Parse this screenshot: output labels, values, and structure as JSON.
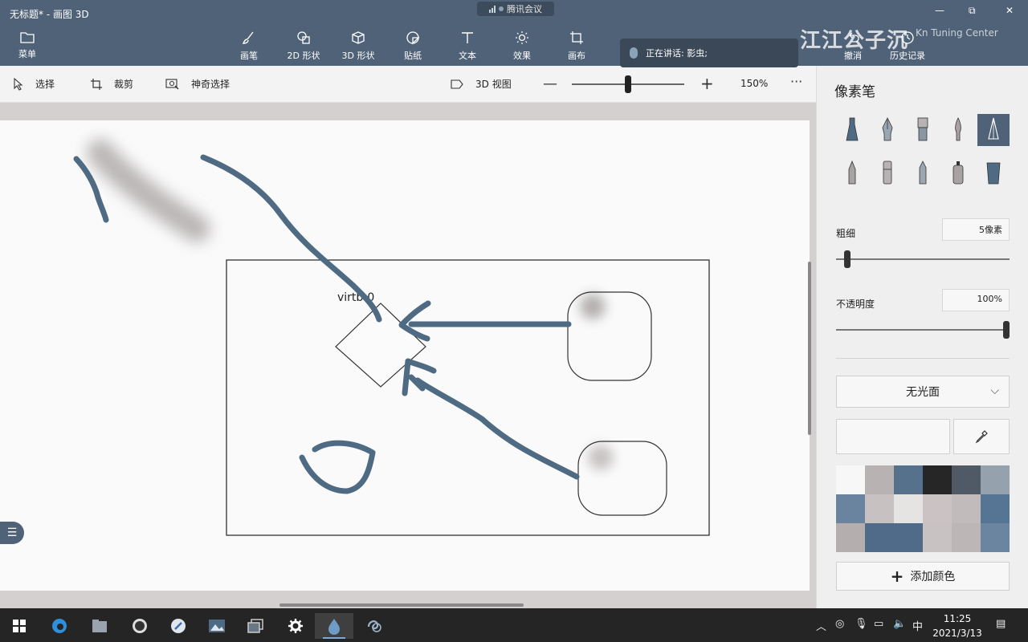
{
  "window": {
    "title": "无标题* - 画图 3D"
  },
  "meeting": {
    "label": "腾讯会议"
  },
  "speaker": {
    "label": "正在讲话: 影虫;"
  },
  "watermark": {
    "text": "江江公子沉",
    "brand": "Kn   Tuning Center"
  },
  "ribbon": {
    "menu": "菜单",
    "tools": [
      "画笔",
      "2D 形状",
      "3D 形状",
      "贴纸",
      "文本",
      "效果",
      "画布"
    ],
    "undo": "撤消",
    "history": "历史记录"
  },
  "toolbar": {
    "select": "选择",
    "crop": "裁剪",
    "magic_select": "神奇选择",
    "view3d": "3D 视图",
    "zoom": "150%",
    "zoom_fraction": 0.5
  },
  "canvas": {
    "node_label": "virtb-0"
  },
  "panel": {
    "title": "像素笔",
    "thickness_label": "粗细",
    "thickness_value": "5像素",
    "thickness_fraction": 0.05,
    "opacity_label": "不透明度",
    "opacity_value": "100%",
    "opacity_fraction": 1.0,
    "finish": "无光面",
    "add_color": "添加颜色",
    "palette": [
      "#f7f7f7",
      "#b9b2b2",
      "#56718c",
      "#262626",
      "#4f5a66",
      "#95a2ae",
      "#6a84a0",
      "#c7c1c1",
      "#e6e3e3",
      "#cbc3c3",
      "#c2bbbb",
      "#567595",
      "#b5aeae",
      "#4f6b89",
      "#4f6b89",
      "#c8c2c2",
      "#bdb6b6",
      "#6b85a0"
    ]
  },
  "taskbar": {
    "time": "11:25",
    "date": "2021/3/13",
    "ime": "中"
  },
  "colors": {
    "accent": "#4f6277",
    "stroke": "#4f6b83"
  }
}
